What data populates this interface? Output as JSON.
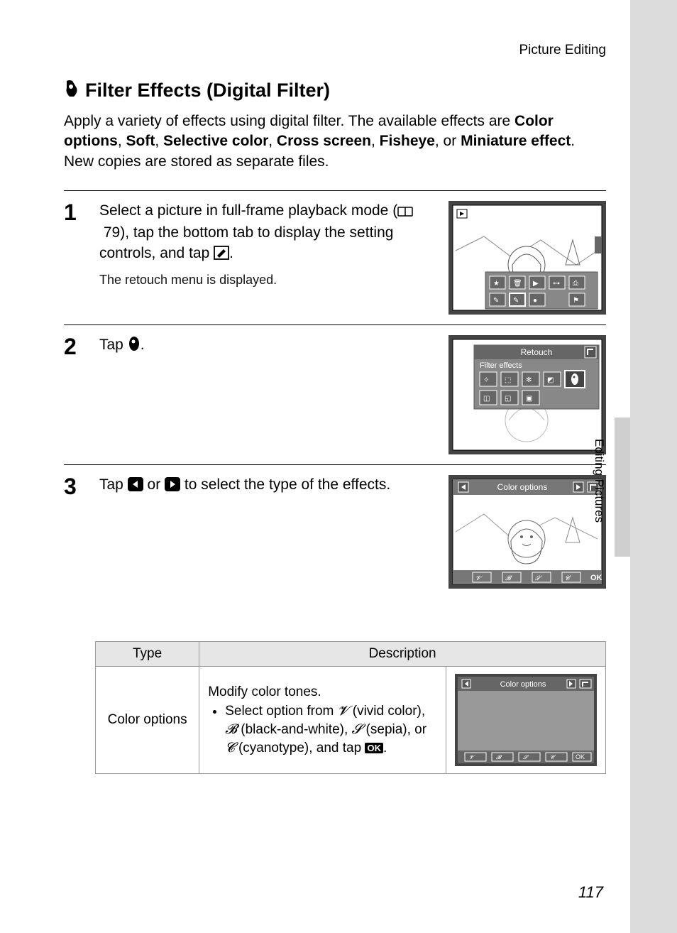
{
  "header": {
    "section": "Picture Editing"
  },
  "title": "Filter Effects (Digital Filter)",
  "intro": {
    "lead": "Apply a variety of effects using digital filter. The available effects are ",
    "opts": [
      "Color options",
      "Soft",
      "Selective color",
      "Cross screen",
      "Fisheye",
      "Miniature effect"
    ],
    "tail": ". New copies are stored as separate files."
  },
  "steps": [
    {
      "n": "1",
      "text_a": "Select a picture in full-frame playback mode (",
      "ref": "79",
      "text_b": "), tap the bottom tab to display the setting controls, and tap ",
      "text_c": ".",
      "sub": "The retouch menu is displayed."
    },
    {
      "n": "2",
      "text_a": "Tap ",
      "text_c": ".",
      "panel_title": "Retouch",
      "panel_sub": "Filter effects"
    },
    {
      "n": "3",
      "text_a": "Tap ",
      "text_mid": " or ",
      "text_b": " to select the type of the effects.",
      "panel_title": "Color options",
      "panel_ok": "OK"
    }
  ],
  "table": {
    "headers": [
      "Type",
      "Description"
    ],
    "rows": [
      {
        "type": "Color options",
        "desc_lead": "Modify color tones.",
        "bullet_a": "Select option from ",
        "opt1": " (vivid color), ",
        "opt2": " (black-and-white), ",
        "opt3": " (sepia), or ",
        "opt4": " (cyanotype), and tap ",
        "bullet_end": ".",
        "panel_title": "Color options",
        "panel_ok": "OK"
      }
    ]
  },
  "side_label": "Editing Pictures",
  "page_number": "117"
}
